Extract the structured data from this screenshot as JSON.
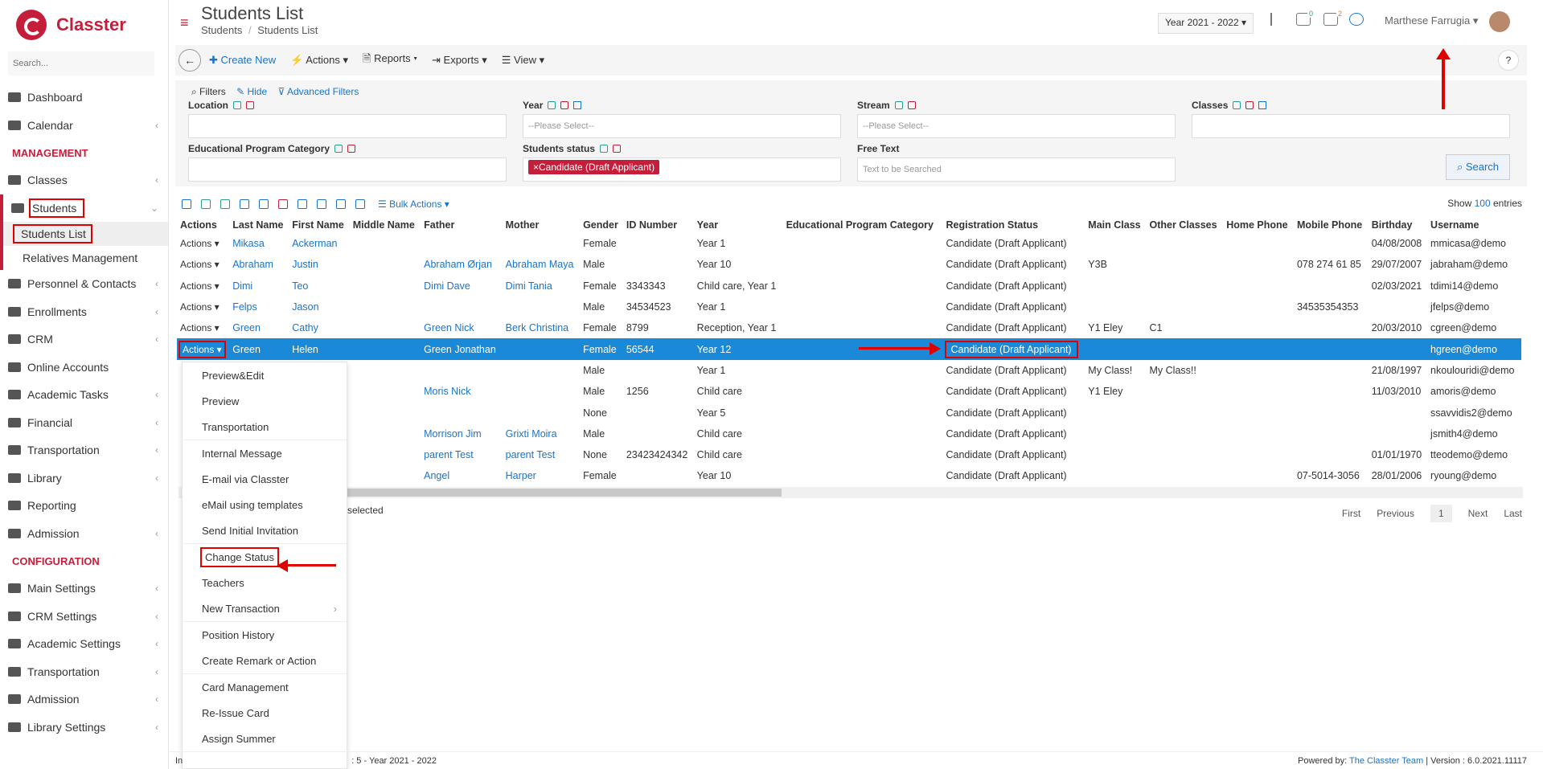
{
  "brand": {
    "name": "Classter"
  },
  "sidebar": {
    "search_placeholder": "Search...",
    "items_top": [
      {
        "label": "Dashboard"
      },
      {
        "label": "Calendar",
        "chev": "‹"
      }
    ],
    "section_management": "MANAGEMENT",
    "items_mgmt": [
      {
        "label": "Classes",
        "chev": "‹"
      }
    ],
    "students": {
      "label": "Students",
      "chev": "⌄"
    },
    "sub_items": [
      {
        "label": "Students List"
      },
      {
        "label": "Relatives Management"
      }
    ],
    "items_mgmt2": [
      {
        "label": "Personnel & Contacts",
        "chev": "‹"
      },
      {
        "label": "Enrollments",
        "chev": "‹"
      },
      {
        "label": "CRM",
        "chev": "‹"
      },
      {
        "label": "Online Accounts"
      },
      {
        "label": "Academic Tasks",
        "chev": "‹"
      },
      {
        "label": "Financial",
        "chev": "‹"
      },
      {
        "label": "Transportation",
        "chev": "‹"
      },
      {
        "label": "Library",
        "chev": "‹"
      },
      {
        "label": "Reporting"
      },
      {
        "label": "Admission",
        "chev": "‹"
      }
    ],
    "section_config": "CONFIGURATION",
    "items_config": [
      {
        "label": "Main Settings",
        "chev": "‹"
      },
      {
        "label": "CRM Settings",
        "chev": "‹"
      },
      {
        "label": "Academic Settings",
        "chev": "‹"
      },
      {
        "label": "Transportation",
        "chev": "‹"
      },
      {
        "label": "Admission",
        "chev": "‹"
      },
      {
        "label": "Library Settings",
        "chev": "‹"
      }
    ]
  },
  "header": {
    "title": "Students List",
    "crumb_1": "Students",
    "crumb_sep": "/",
    "crumb_2": "Students List",
    "year": "Year 2021 - 2022 ▾",
    "notif_count": "0",
    "msg_count": "2",
    "user": "Marthese Farrugia ▾"
  },
  "toolbar": {
    "create": "✚ Create New",
    "actions": "⚡ Actions ▾",
    "reports": "🗎 Reports ▾",
    "exports": "⇥ Exports ▾",
    "view": "☰ View ▾",
    "help": "?"
  },
  "filters": {
    "title": "⌕ Filters",
    "hide": "✎ Hide",
    "advanced": "⊽ Advanced Filters",
    "location": "Location",
    "year": "Year",
    "year_ph": "--Please Select--",
    "stream": "Stream",
    "stream_ph": "--Please Select--",
    "classes": "Classes",
    "edu_cat": "Educational Program Category",
    "status": "Students status",
    "status_chip": "×Candidate (Draft Applicant)",
    "free_text": "Free Text",
    "free_text_ph": "Text to be Searched",
    "search": "⌕ Search"
  },
  "table": {
    "bulk": "☰ Bulk Actions ▾",
    "show_prefix": "Show ",
    "show_count": "100",
    "show_suffix": " entries",
    "columns": [
      "Actions",
      "Last Name",
      "First Name",
      "Middle Name",
      "Father",
      "Mother",
      "Gender",
      "ID Number",
      "Year",
      "Educational Program Category",
      "Registration Status",
      "Main Class",
      "Other Classes",
      "Home Phone",
      "Mobile Phone",
      "Birthday",
      "Username"
    ],
    "rows": [
      [
        "Actions ▾",
        "Mikasa",
        "Ackerman",
        "",
        "",
        "",
        "Female",
        "",
        "Year 1",
        "",
        "Candidate (Draft Applicant)",
        "",
        "",
        "",
        "",
        "04/08/2008",
        "mmicasa@demo"
      ],
      [
        "Actions ▾",
        "Abraham",
        "Justin",
        "",
        "Abraham Ørjan",
        "Abraham Maya",
        "Male",
        "",
        "Year 10",
        "",
        "Candidate (Draft Applicant)",
        "Y3B",
        "",
        "",
        "078 274 61 85",
        "29/07/2007",
        "jabraham@demo"
      ],
      [
        "Actions ▾",
        "Dimi",
        "Teo",
        "",
        "Dimi Dave",
        "Dimi Tania",
        "Female",
        "3343343",
        "Child care, Year 1",
        "",
        "Candidate (Draft Applicant)",
        "",
        "",
        "",
        "",
        "02/03/2021",
        "tdimi14@demo"
      ],
      [
        "Actions ▾",
        "Felps",
        "Jason",
        "",
        "",
        "",
        "Male",
        "34534523",
        "Year 1",
        "",
        "Candidate (Draft Applicant)",
        "",
        "",
        "",
        "34535354353",
        "",
        "jfelps@demo"
      ],
      [
        "Actions ▾",
        "Green",
        "Cathy",
        "",
        "Green Nick",
        "Berk Christina",
        "Female",
        "8799",
        "Reception, Year 1",
        "",
        "Candidate (Draft Applicant)",
        "Y1 Eley",
        "C1",
        "",
        "",
        "20/03/2010",
        "cgreen@demo"
      ],
      [
        "Actions ▾",
        "Green",
        "Helen",
        "",
        "Green Jonathan",
        "",
        "Female",
        "56544",
        "Year 12",
        "",
        "Candidate (Draft Applicant)",
        "",
        "",
        "",
        "",
        "",
        "hgreen@demo"
      ],
      [
        "",
        "",
        "",
        "",
        "",
        "",
        "Male",
        "",
        "Year 1",
        "",
        "Candidate (Draft Applicant)",
        "My Class!",
        "My Class!!",
        "",
        "",
        "21/08/1997",
        "nkoulouridi@demo"
      ],
      [
        "",
        "",
        "",
        "",
        "Moris Nick",
        "",
        "Male",
        "1256",
        "Child care",
        "",
        "Candidate (Draft Applicant)",
        "Y1 Eley",
        "",
        "",
        "",
        "11/03/2010",
        "amoris@demo"
      ],
      [
        "",
        "",
        "",
        "",
        "",
        "",
        "None",
        "",
        "Year 5",
        "",
        "Candidate (Draft Applicant)",
        "",
        "",
        "",
        "",
        "",
        "ssavvidis2@demo"
      ],
      [
        "",
        "",
        "",
        "",
        "Morrison Jim",
        "Grixti Moira",
        "Male",
        "",
        "Child care",
        "",
        "Candidate (Draft Applicant)",
        "",
        "",
        "",
        "",
        "",
        "jsmith4@demo"
      ],
      [
        "",
        "",
        "",
        "",
        "parent Test",
        "parent Test",
        "None",
        "23423424342",
        "Child care",
        "",
        "Candidate (Draft Applicant)",
        "",
        "",
        "",
        "",
        "01/01/1970",
        "tteodemo@demo"
      ],
      [
        "",
        "",
        "",
        "",
        "Angel",
        "Harper",
        "Female",
        "",
        "Year 10",
        "",
        "Candidate (Draft Applicant)",
        "",
        "",
        "",
        "07-5014-3056",
        "28/01/2006",
        "ryoung@demo"
      ]
    ],
    "selected_text": "selected",
    "pager": {
      "first": "First",
      "previous": "Previous",
      "page": "1",
      "next": "Next",
      "last": "Last"
    }
  },
  "dropdown": {
    "items": [
      "Preview&Edit",
      "Preview",
      "Transportation",
      "Internal Message",
      "E-mail via Classter",
      "eMail using templates",
      "Send Initial Invitation",
      "Change Status",
      "Teachers",
      "New Transaction",
      "Position History",
      "Create Remark or Action",
      "Card Management",
      "Re-Issue Card",
      "Assign Summer"
    ]
  },
  "footer": {
    "left": "In",
    "left2": ": 5 - Year 2021 - 2022",
    "powered": "Powered by: ",
    "team": "The Classter Team",
    "version": "Version : 6.0.2021.11117"
  },
  "colors": {
    "brand": "#c41e3a",
    "selected_row": "#1a8ad8",
    "link": "#1a73c9",
    "highlight": "#e00000"
  }
}
